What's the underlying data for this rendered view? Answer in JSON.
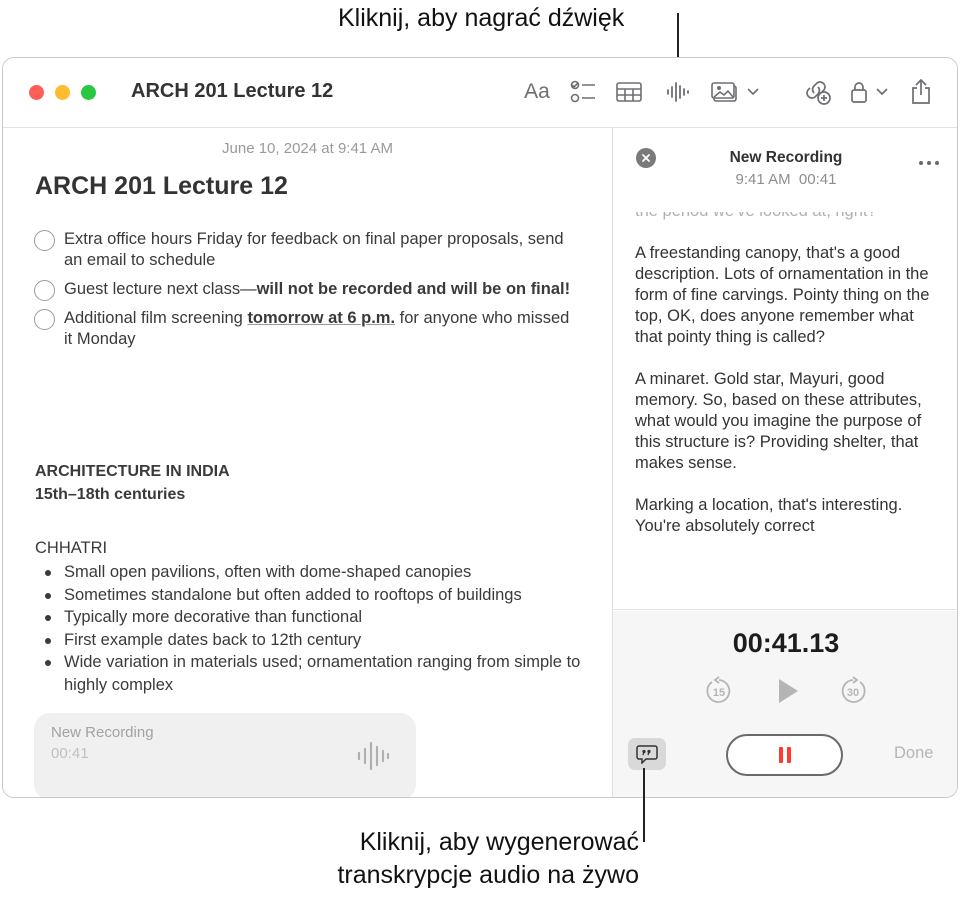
{
  "callouts": {
    "record_sound": "Kliknij, aby nagrać dźwięk",
    "live_transcript_line1": "Kliknij, aby wygenerować",
    "live_transcript_line2": "transkrypcje audio na żywo"
  },
  "window": {
    "title": "ARCH 201 Lecture 12",
    "toolbar_icons": [
      "format-text-icon",
      "checklist-icon",
      "table-icon",
      "audio-record-icon",
      "media-icon",
      "collaborate-icon",
      "lock-icon",
      "share-icon"
    ],
    "format_label": "Aa"
  },
  "note": {
    "date": "June 10, 2024 at 9:41 AM",
    "title": "ARCH 201 Lecture 12",
    "checklist": [
      {
        "text": "Extra office hours Friday for feedback on final paper proposals, send an email to schedule"
      },
      {
        "prefix": "Guest lecture next class—",
        "bold": "will not be recorded and will be on final!"
      },
      {
        "prefix": "Additional film screening ",
        "underline": "tomorrow at 6 p.m.",
        "suffix": " for anyone who missed it Monday"
      }
    ],
    "section_title": "ARCHITECTURE IN INDIA",
    "section_subtitle": "15th–18th centuries",
    "subheading": "CHHATRI",
    "bullets": [
      "Small open pavilions, often with dome-shaped canopies",
      "Sometimes standalone but often added to rooftops of buildings",
      "Typically more decorative than functional",
      "First example dates back to 12th century",
      "Wide variation in materials used; ornamentation ranging from simple to highly complex"
    ],
    "recording_card": {
      "title": "New Recording",
      "duration": "00:41"
    }
  },
  "recording": {
    "title": "New Recording",
    "subtitle": "9:41 AM  00:41",
    "transcript": [
      "the period we've looked at, right?",
      "A freestanding canopy, that's a good description. Lots of ornamentation in the form of fine carvings. Pointy thing on the top, OK, does anyone remember what that pointy thing is called?",
      "A minaret. Gold star, Mayuri, good memory. So, based on these attributes, what would you imagine the purpose of this structure is? Providing shelter, that makes sense.",
      "Marking a location, that's interesting. You're absolutely correct"
    ],
    "timer": "00:41.13",
    "skip_back": "15",
    "skip_forward": "30",
    "done_label": "Done",
    "pause_color": "#ff3b30"
  }
}
